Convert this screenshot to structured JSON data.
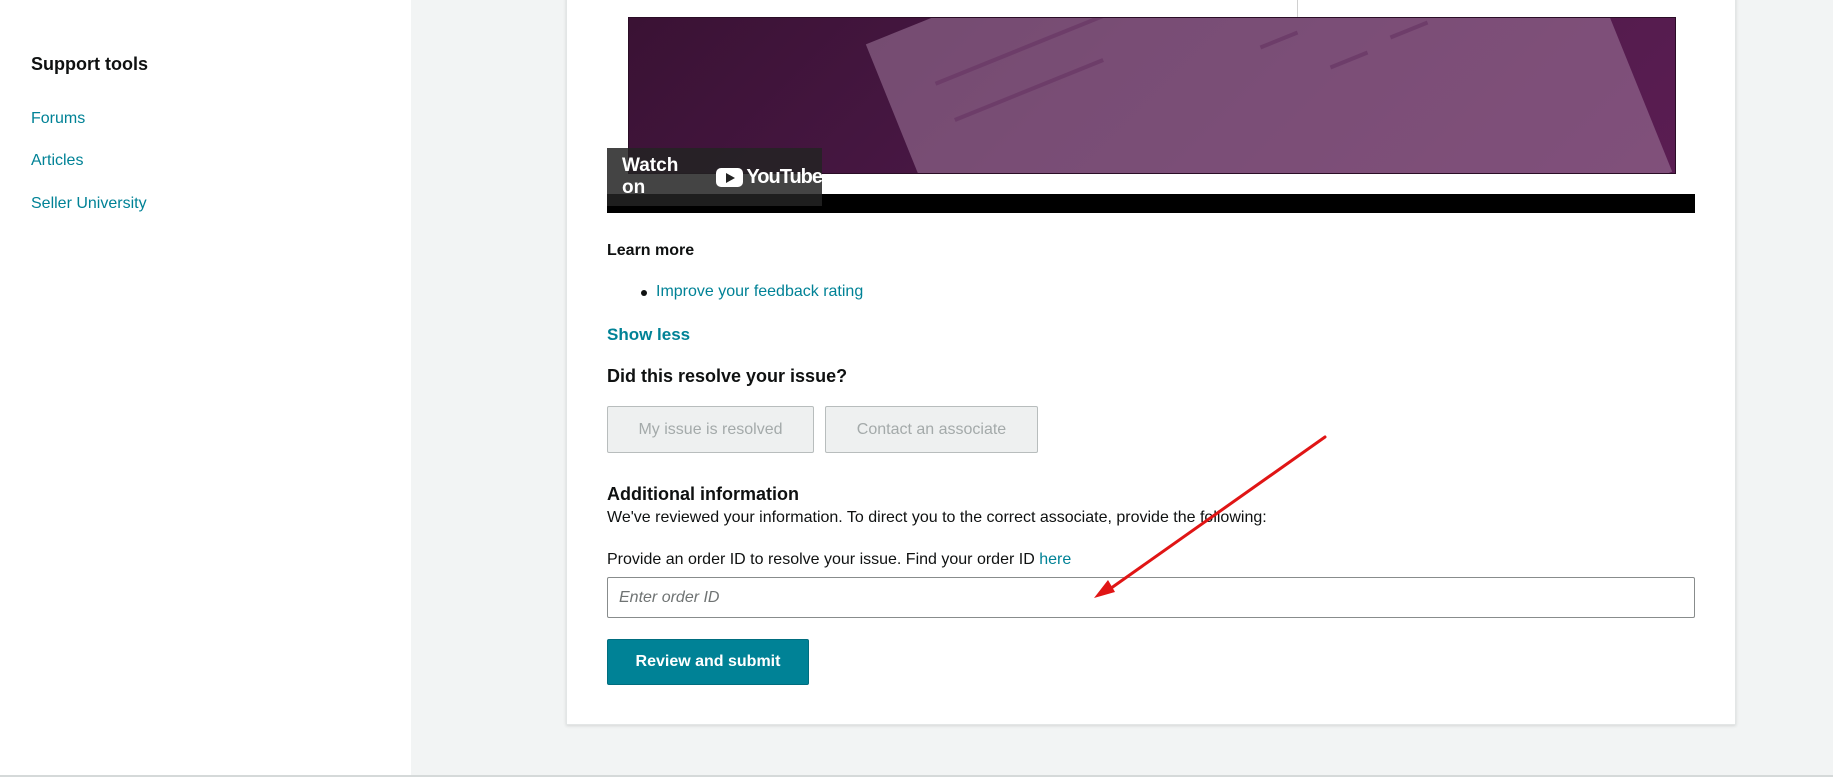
{
  "sidebar": {
    "title": "Support tools",
    "links": [
      {
        "label": "Forums"
      },
      {
        "label": "Articles"
      },
      {
        "label": "Seller University"
      }
    ]
  },
  "video": {
    "watch_label": "Watch on",
    "brand": "YouTube"
  },
  "learn_more": {
    "heading": "Learn more",
    "links": [
      {
        "label": "Improve your feedback rating"
      }
    ],
    "toggle_label": "Show less"
  },
  "resolution": {
    "question": "Did this resolve your issue?",
    "resolved_label": "My issue is resolved",
    "contact_label": "Contact an associate"
  },
  "additional_info": {
    "title": "Additional information",
    "description": "We've reviewed your information. To direct you to the correct associate, provide the following:",
    "order_prompt": "Provide an order ID to resolve your issue. Find your order ID",
    "order_link": "here",
    "order_placeholder": "Enter order ID",
    "order_value": "",
    "submit_label": "Review and submit"
  },
  "annotation": {
    "arrow_color": "#e01515"
  },
  "colors": {
    "accent": "#008296",
    "page_bg": "#f2f4f4",
    "text": "#0f1111"
  }
}
